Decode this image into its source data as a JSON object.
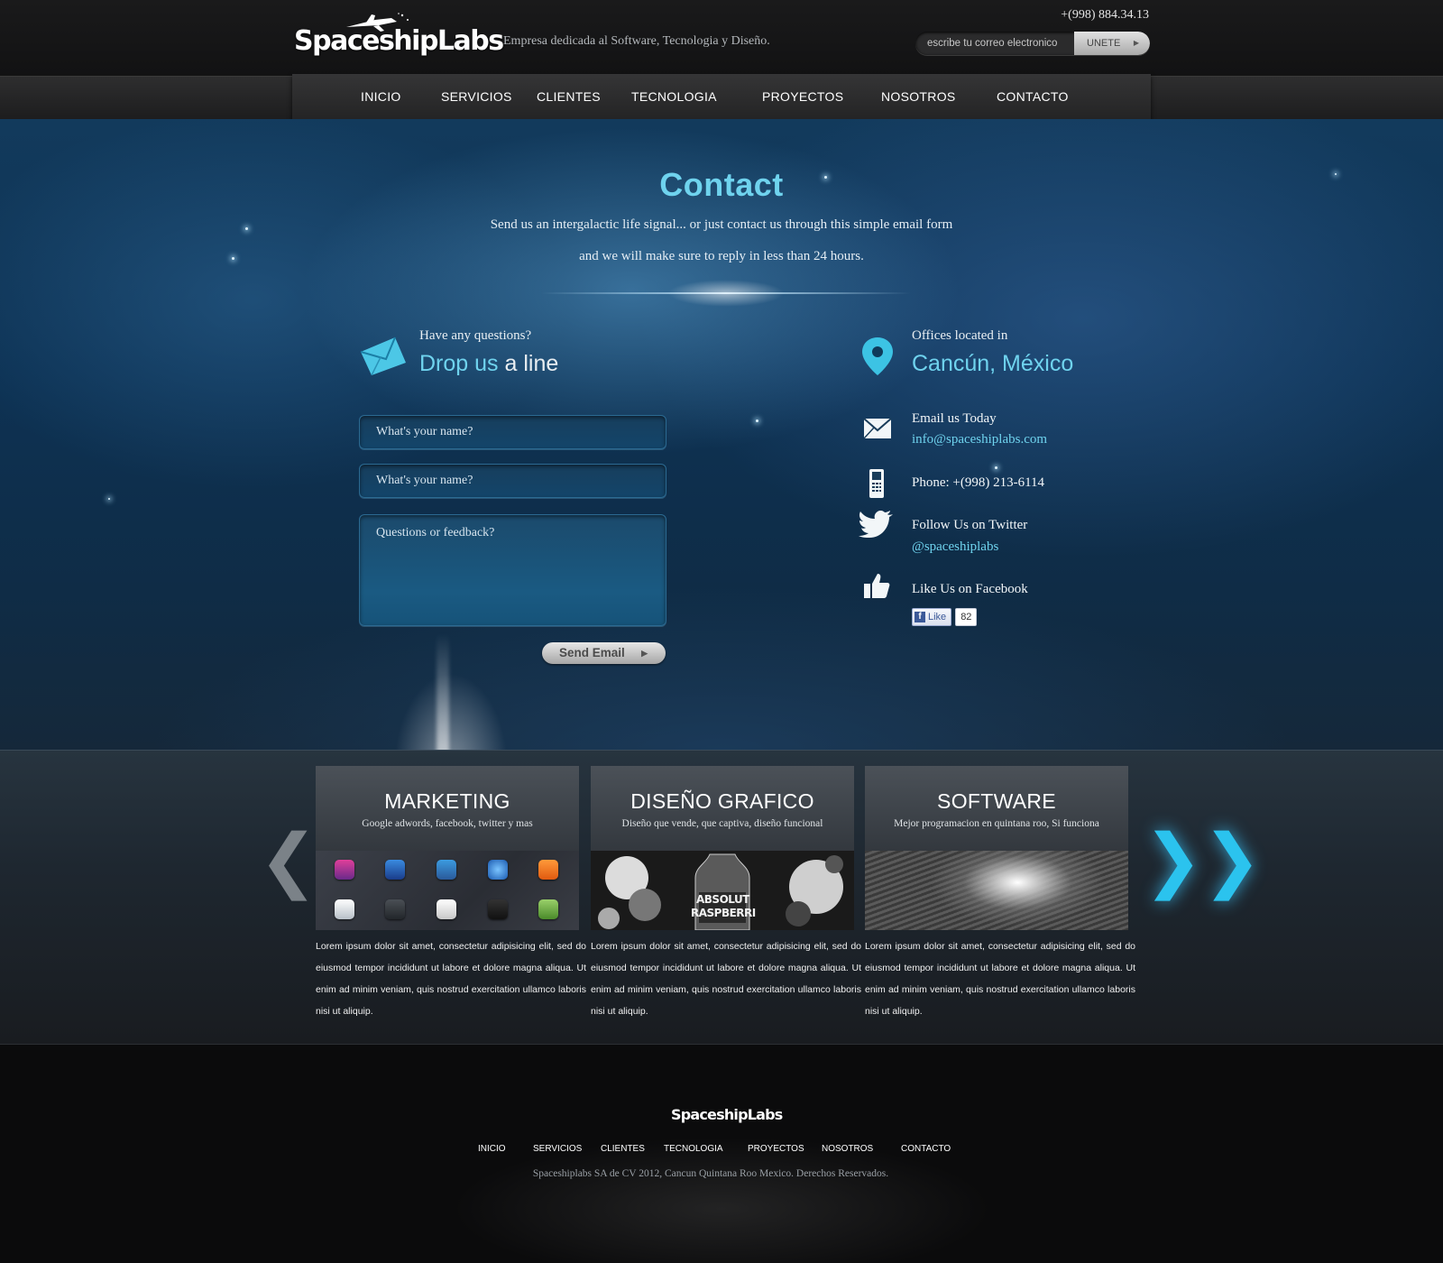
{
  "header": {
    "logo": "SpaceshipLabs",
    "tagline": "Empresa dedicada al Software, Tecnologia y Diseño.",
    "phone": "+(998) 884.34.13",
    "newsletter_placeholder": "escribe tu correo electronico",
    "newsletter_button": "UNETE"
  },
  "nav": [
    "INICIO",
    "SERVICIOS",
    "CLIENTES",
    "TECNOLOGIA",
    "PROYECTOS",
    "NOSOTROS",
    "CONTACTO"
  ],
  "hero": {
    "title": "Contact",
    "line1": "Send us an intergalactic life signal... or just contact us through this simple email form",
    "line2": "and we will make sure to reply in less than 24 hours."
  },
  "form": {
    "question": "Have any questions?",
    "heading_highlight": "Drop us",
    "heading_rest": " a line",
    "name_placeholder": "What's your name?",
    "second_placeholder": "What's your name?",
    "message_placeholder": "Questions or feedback?",
    "send_label": "Send Email"
  },
  "contact_info": {
    "offices_label": "Offices located in",
    "city": "Cancún, México",
    "email_label": "Email us Today",
    "email": "info@spaceshiplabs.com",
    "phone": "Phone: +(998) 213-6114",
    "twitter_label": "Follow Us on Twitter",
    "twitter": "@spaceshiplabs",
    "facebook_label": "Like Us on Facebook",
    "fb_like": "Like",
    "fb_count": "82"
  },
  "services": [
    {
      "title": "MARKETING",
      "subtitle": "Google adwords, facebook, twitter y mas",
      "text": "Lorem ipsum dolor sit amet, consectetur adipisicing elit, sed do eiusmod tempor incididunt ut labore et dolore magna aliqua. Ut enim ad minim veniam, quis nostrud exercitation ullamco laboris nisi ut aliquip."
    },
    {
      "title": "DISEÑO GRAFICO",
      "subtitle": "Diseño que vende, que captiva, diseño funcional",
      "text": "Lorem ipsum dolor sit amet, consectetur adipisicing elit, sed do eiusmod tempor incididunt ut labore et dolore magna aliqua. Ut enim ad minim veniam, quis nostrud exercitation ullamco laboris nisi ut aliquip.",
      "image_text_1": "ABSOLUT",
      "image_text_2": "RASPBERRI"
    },
    {
      "title": "SOFTWARE",
      "subtitle": "Mejor programacion en quintana roo, Si funciona",
      "text": "Lorem ipsum dolor sit amet, consectetur adipisicing elit, sed do eiusmod tempor incididunt ut labore et dolore magna aliqua. Ut enim ad minim veniam, quis nostrud exercitation ullamco laboris nisi ut aliquip."
    }
  ],
  "carousel": {
    "prev": "❮❮",
    "next": "❯❯"
  },
  "footer": {
    "logo": "SpaceshipLabs",
    "nav": [
      "INICIO",
      "SERVICIOS",
      "CLIENTES",
      "TECNOLOGIA",
      "PROYECTOS",
      "NOSOTROS",
      "CONTACTO"
    ],
    "copyright": "Spaceshiplabs SA de CV 2012, Cancun Quintana Roo Mexico. Derechos Reservados."
  },
  "colors": {
    "accent": "#6fd3ee",
    "background": "#0b0b0c",
    "nav": "#2a2a2b"
  }
}
